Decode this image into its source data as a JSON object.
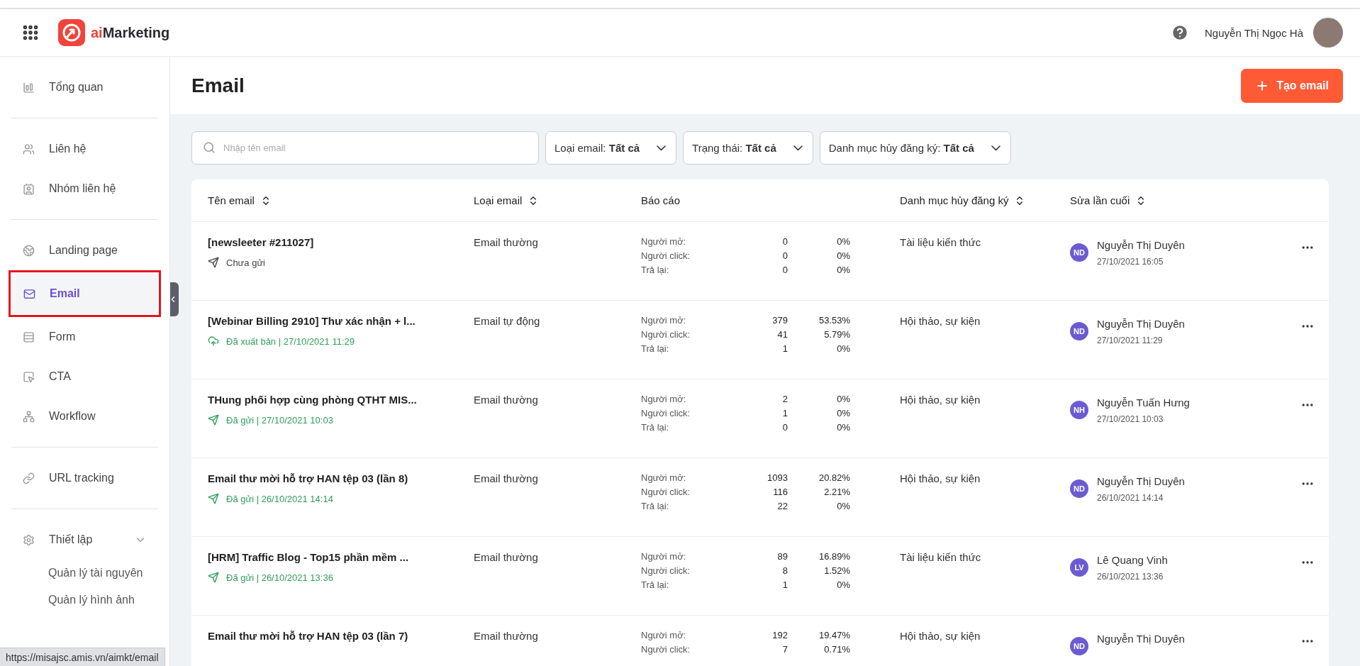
{
  "topbar": {
    "brand": {
      "accent": "ai",
      "rest": "Marketing"
    },
    "user_name": "Nguyễn Thị Ngọc Hà"
  },
  "sidebar": {
    "sections": [
      {
        "items": [
          {
            "label": "Tổng quan",
            "selected": false
          }
        ]
      },
      {
        "items": [
          {
            "label": "Liên hệ",
            "selected": false
          },
          {
            "label": "Nhóm liên hệ",
            "selected": false
          }
        ]
      },
      {
        "items": [
          {
            "label": "Landing page",
            "selected": false
          },
          {
            "label": "Email",
            "selected": true,
            "annotated": true
          },
          {
            "label": "Form",
            "selected": false
          },
          {
            "label": "CTA",
            "selected": false
          },
          {
            "label": "Workflow",
            "selected": false
          }
        ]
      },
      {
        "items": [
          {
            "label": "URL tracking",
            "selected": false
          }
        ]
      },
      {
        "items": [
          {
            "label": "Thiết lập",
            "selected": false,
            "expanded": true,
            "children": [
              {
                "label": "Quản lý tài nguyên"
              },
              {
                "label": "Quản lý hình ảnh"
              }
            ]
          }
        ]
      }
    ]
  },
  "page": {
    "title": "Email",
    "create_button": "Tạo email"
  },
  "filters": {
    "search_placeholder": "Nhập tên email",
    "dropdowns": [
      {
        "label": "Loại email: **Tất cả**"
      },
      {
        "label": "Trạng thái: **Tất cả**"
      },
      {
        "label": "Danh mục hủy đăng ký: **Tất cả**"
      }
    ]
  },
  "table": {
    "columns": [
      {
        "label": "Tên email",
        "sortable": true
      },
      {
        "label": "Loại email",
        "sortable": true
      },
      {
        "label": "Báo cáo",
        "sortable": false
      },
      {
        "label": "Danh mục hủy đăng ký",
        "sortable": true
      },
      {
        "label": "Sửa lần cuối",
        "sortable": true
      }
    ],
    "rows": [
      {
        "name": "[newsleeter #211027]",
        "status": {
          "kind": "draft",
          "text": "Chưa gửi"
        },
        "type": "Email thường",
        "report": [
          {
            "label": "Người mở:",
            "count": "0",
            "percent": "0%"
          },
          {
            "label": "Người click:",
            "count": "0",
            "percent": "0%"
          },
          {
            "label": "Trả lại:",
            "count": "0",
            "percent": "0%"
          }
        ],
        "category": "Tài liệu kiến thức",
        "editor": {
          "initials": "ND",
          "name": "Nguyễn Thị Duyên",
          "time": "27/10/2021 16:05"
        }
      },
      {
        "name": "[Webinar Billing 2910] Thư xác nhận + l...",
        "status": {
          "kind": "published",
          "text": "Đã xuất bản | 27/10/2021 11:29"
        },
        "type": "Email tự động",
        "report": [
          {
            "label": "Người mở:",
            "count": "379",
            "percent": "53.53%"
          },
          {
            "label": "Người click:",
            "count": "41",
            "percent": "5.79%"
          },
          {
            "label": "Trả lại:",
            "count": "1",
            "percent": "0%"
          }
        ],
        "category": "Hội thảo, sự kiện",
        "editor": {
          "initials": "ND",
          "name": "Nguyễn Thị Duyên",
          "time": "27/10/2021 11:29"
        }
      },
      {
        "name": "THung phối hợp cùng phòng QTHT MIS...",
        "status": {
          "kind": "sent",
          "text": "Đã gửi | 27/10/2021 10:03"
        },
        "type": "Email thường",
        "report": [
          {
            "label": "Người mở:",
            "count": "2",
            "percent": "0%"
          },
          {
            "label": "Người click:",
            "count": "1",
            "percent": "0%"
          },
          {
            "label": "Trả lại:",
            "count": "0",
            "percent": "0%"
          }
        ],
        "category": "Hội thảo, sự kiện",
        "editor": {
          "initials": "NH",
          "name": "Nguyễn Tuấn Hưng",
          "time": "27/10/2021 10:03"
        }
      },
      {
        "name": "Email thư mời hỗ trợ HAN tệp 03 (lần 8)",
        "status": {
          "kind": "sent",
          "text": "Đã gửi | 26/10/2021 14:14"
        },
        "type": "Email thường",
        "report": [
          {
            "label": "Người mở:",
            "count": "1093",
            "percent": "20.82%"
          },
          {
            "label": "Người click:",
            "count": "116",
            "percent": "2.21%"
          },
          {
            "label": "Trả lại:",
            "count": "22",
            "percent": "0%"
          }
        ],
        "category": "Hội thảo, sự kiện",
        "editor": {
          "initials": "ND",
          "name": "Nguyễn Thị Duyên",
          "time": "26/10/2021 14:14"
        }
      },
      {
        "name": "[HRM] Traffic Blog - Top15 phần mềm ...",
        "status": {
          "kind": "sent",
          "text": "Đã gửi | 26/10/2021 13:36"
        },
        "type": "Email thường",
        "report": [
          {
            "label": "Người mở:",
            "count": "89",
            "percent": "16.89%"
          },
          {
            "label": "Người click:",
            "count": "8",
            "percent": "1.52%"
          },
          {
            "label": "Trả lại:",
            "count": "1",
            "percent": "0%"
          }
        ],
        "category": "Tài liệu kiến thức",
        "editor": {
          "initials": "LV",
          "name": "Lê Quang Vinh",
          "time": "26/10/2021 13:36"
        }
      },
      {
        "name": "Email thư mời hỗ trợ HAN tệp 03 (lần 7)",
        "type": "Email thường",
        "report": [
          {
            "label": "Người mở:",
            "count": "192",
            "percent": "19.47%"
          },
          {
            "label": "Người click:",
            "count": "7",
            "percent": "0.71%"
          }
        ],
        "category": "Hội thảo, sự kiện",
        "editor": {
          "initials": "ND",
          "name": "Nguyễn Thị Duyên"
        }
      }
    ]
  },
  "status_url": "https://misajsc.amis.vn/aimkt/email"
}
